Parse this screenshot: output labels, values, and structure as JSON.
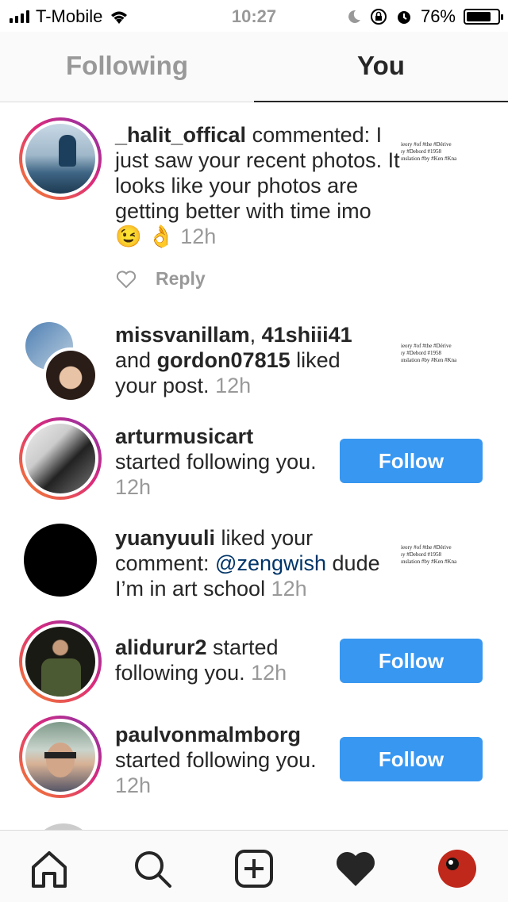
{
  "status_bar": {
    "carrier": "T-Mobile",
    "time": "10:27",
    "battery": "76%"
  },
  "tabs": {
    "following": "Following",
    "you": "You"
  },
  "notifications": [
    {
      "username": "_halit_offical",
      "action": "commented: I just saw your recent photos. It looks like your photos are getting better with time imo",
      "emoji": "😉 👌",
      "time": "12h",
      "reply_label": "Reply",
      "thumb_lines": [
        "ieory #of #the #Dérive",
        "ıy #Debord #1958",
        "ınslation #by #Ken #Kna"
      ]
    },
    {
      "users": [
        "missvanillam",
        "41shiii41",
        "gordon07815"
      ],
      "sep1": ", ",
      "sep2": " and ",
      "action": " liked your post. ",
      "time": "12h",
      "thumb_lines": [
        "ieory #of #the #Dérive",
        "ıy #Debord #1958",
        "ınslation #by #Ken #Kna"
      ]
    },
    {
      "username": "arturmusicart",
      "action": "started following you. ",
      "time": "12h",
      "button": "Follow"
    },
    {
      "username": "yuanyuuli",
      "action": " liked your comment: ",
      "mention": "@zengwish",
      "rest": " dude I’m in art school ",
      "time": "12h",
      "thumb_lines": [
        "ieory #of #the #Dérive",
        "ıy #Debord #1958",
        "ınslation #by #Ken #Kna"
      ]
    },
    {
      "username": "alidurur2",
      "action": " started following you. ",
      "time": "12h",
      "button": "Follow"
    },
    {
      "username": "paulvonmalmborg",
      "action": "started following you. ",
      "time": "12h",
      "button": "Follow"
    }
  ],
  "bottom_nav": [
    "home-icon",
    "search-icon",
    "add-post-icon",
    "activity-heart-icon",
    "profile-avatar-icon"
  ]
}
